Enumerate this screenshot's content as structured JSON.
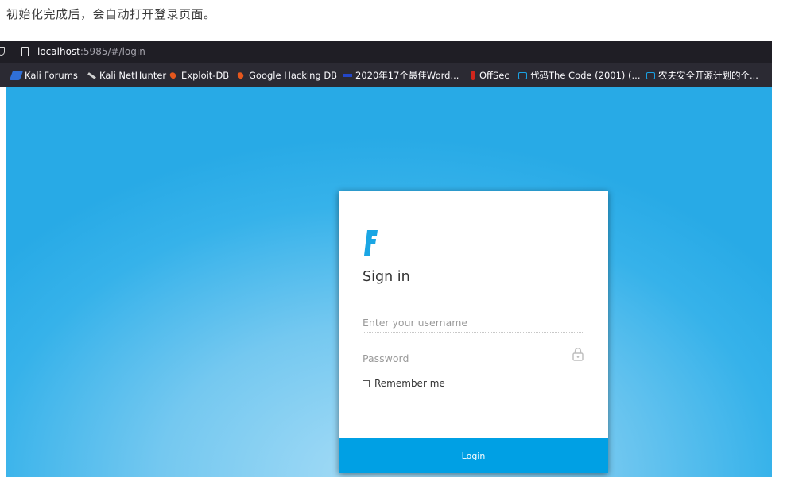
{
  "caption": "初始化完成后，会自动打开登录页面。",
  "browser": {
    "url_host": "localhost",
    "url_rest": ":5985/#/login",
    "bookmarks": [
      {
        "label": "Kali Forums",
        "icon": "kali-icon"
      },
      {
        "label": "Kali NetHunter",
        "icon": "nethunter-icon"
      },
      {
        "label": "Exploit-DB",
        "icon": "exploitdb-icon"
      },
      {
        "label": "Google Hacking DB",
        "icon": "ghdb-icon"
      },
      {
        "label": "2020年17个最佳Word...",
        "icon": "bookmark-bar-icon"
      },
      {
        "label": "OffSec",
        "icon": "offsec-icon"
      },
      {
        "label": "代码The Code (2001) (...",
        "icon": "bilibili-icon"
      },
      {
        "label": "农夫安全开源计划的个...",
        "icon": "bilibili-icon"
      }
    ]
  },
  "login": {
    "title": "Sign in",
    "username_placeholder": "Enter your username",
    "password_placeholder": "Password",
    "remember_label": "Remember me",
    "button_label": "Login",
    "logo_icon": "brand-f-logo-icon",
    "accent_color": "#00a0e4",
    "background_color": "#36b2ea"
  }
}
